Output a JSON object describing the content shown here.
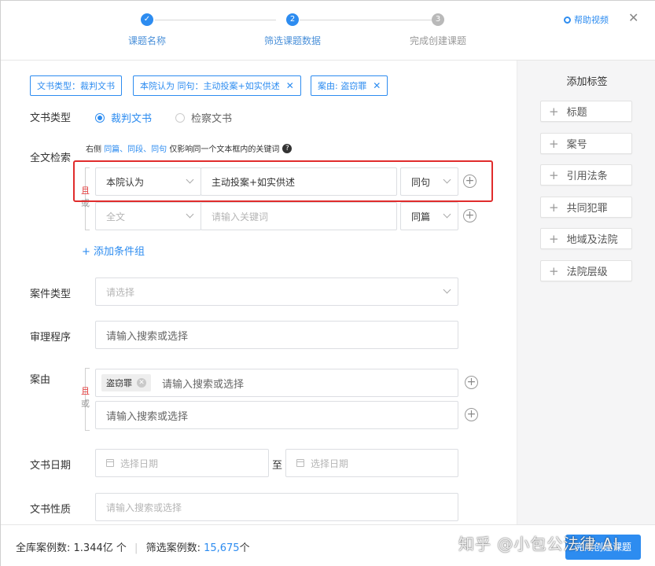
{
  "steps": [
    {
      "num": "✓",
      "label": "课题名称",
      "state": "done"
    },
    {
      "num": "2",
      "label": "筛选课题数据",
      "state": "active"
    },
    {
      "num": "3",
      "label": "完成创建课题",
      "state": "todo"
    }
  ],
  "help_label": "帮助视频",
  "close_glyph": "✕",
  "right_panel": {
    "title": "添加标签",
    "items": [
      "标题",
      "案号",
      "引用法条",
      "共同犯罪",
      "地域及法院",
      "法院层级"
    ]
  },
  "chips": [
    {
      "label": "文书类型：裁判文书",
      "removable": false
    },
    {
      "label": "本院认为 同句：主动投案+如实供述",
      "removable": true
    },
    {
      "label": "案由: 盗窃罪",
      "removable": true
    }
  ],
  "doc_type": {
    "label": "文书类型",
    "options": [
      "裁判文书",
      "检察文书"
    ],
    "selected": "裁判文书"
  },
  "fulltext": {
    "label": "全文检索",
    "hint_prefix": "右侧",
    "hint_links": "同篇、同段、同句",
    "hint_suffix": "仅影响同一个文本框内的关键词",
    "and": "且",
    "or": "或",
    "rows": [
      {
        "field": "本院认为",
        "keyword": "主动投案+如实供述",
        "scope": "同句"
      },
      {
        "field": "全文",
        "keyword_placeholder": "请输入关键词",
        "scope": "同篇"
      }
    ],
    "add_group": "+ 添加条件组"
  },
  "case_type": {
    "label": "案件类型",
    "placeholder": "请选择"
  },
  "trial_procedure": {
    "label": "审理程序",
    "placeholder": "请输入搜索或选择"
  },
  "cause": {
    "label": "案由",
    "and": "且",
    "or": "或",
    "tag": "盗窃罪",
    "placeholder1": "请输入搜索或选择",
    "placeholder2": "请输入搜索或选择"
  },
  "doc_date": {
    "label": "文书日期",
    "from": "选择日期",
    "to_word": "至",
    "to": "选择日期"
  },
  "doc_nature": {
    "label": "文书性质",
    "placeholder": "请输入搜索或选择"
  },
  "footer": {
    "total_label": "全库案例数:",
    "total_value": "1.344亿 个",
    "filter_label": "筛选案例数:",
    "filter_value": "15,675",
    "filter_unit": "个",
    "create_button": "完成创建课题",
    "watermark": "知乎 @小包公法律·AI"
  },
  "colors": {
    "accent": "#2d8cf0",
    "highlight": "#e02c2c"
  }
}
